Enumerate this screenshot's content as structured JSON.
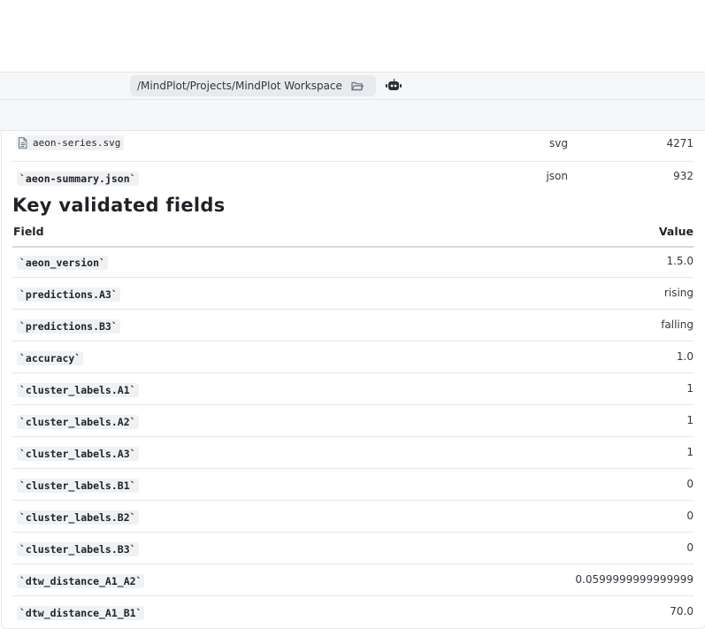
{
  "toolbar": {
    "path": "/MindPlot/Projects/MindPlot Workspace",
    "folder_icon": "folder-open-icon",
    "bot_icon": "robot-icon"
  },
  "files": [
    {
      "name": "aeon-series.svg",
      "type": "svg",
      "size": "4271",
      "icon": "file-icon"
    },
    {
      "name": "`aeon-summary.json`",
      "type": "json",
      "size": "932"
    }
  ],
  "section": {
    "title": "Key validated fields",
    "headers": {
      "field": "Field",
      "value": "Value"
    },
    "rows": [
      {
        "field": "`aeon_version`",
        "value": "1.5.0"
      },
      {
        "field": "`predictions.A3`",
        "value": "rising"
      },
      {
        "field": "`predictions.B3`",
        "value": "falling"
      },
      {
        "field": "`accuracy`",
        "value": "1.0"
      },
      {
        "field": "`cluster_labels.A1`",
        "value": "1"
      },
      {
        "field": "`cluster_labels.A2`",
        "value": "1"
      },
      {
        "field": "`cluster_labels.A3`",
        "value": "1"
      },
      {
        "field": "`cluster_labels.B1`",
        "value": "0"
      },
      {
        "field": "`cluster_labels.B2`",
        "value": "0"
      },
      {
        "field": "`cluster_labels.B3`",
        "value": "0"
      },
      {
        "field": "`dtw_distance_A1_A2`",
        "value": "0.0599999999999999"
      },
      {
        "field": "`dtw_distance_A1_B1`",
        "value": "70.0"
      }
    ]
  }
}
